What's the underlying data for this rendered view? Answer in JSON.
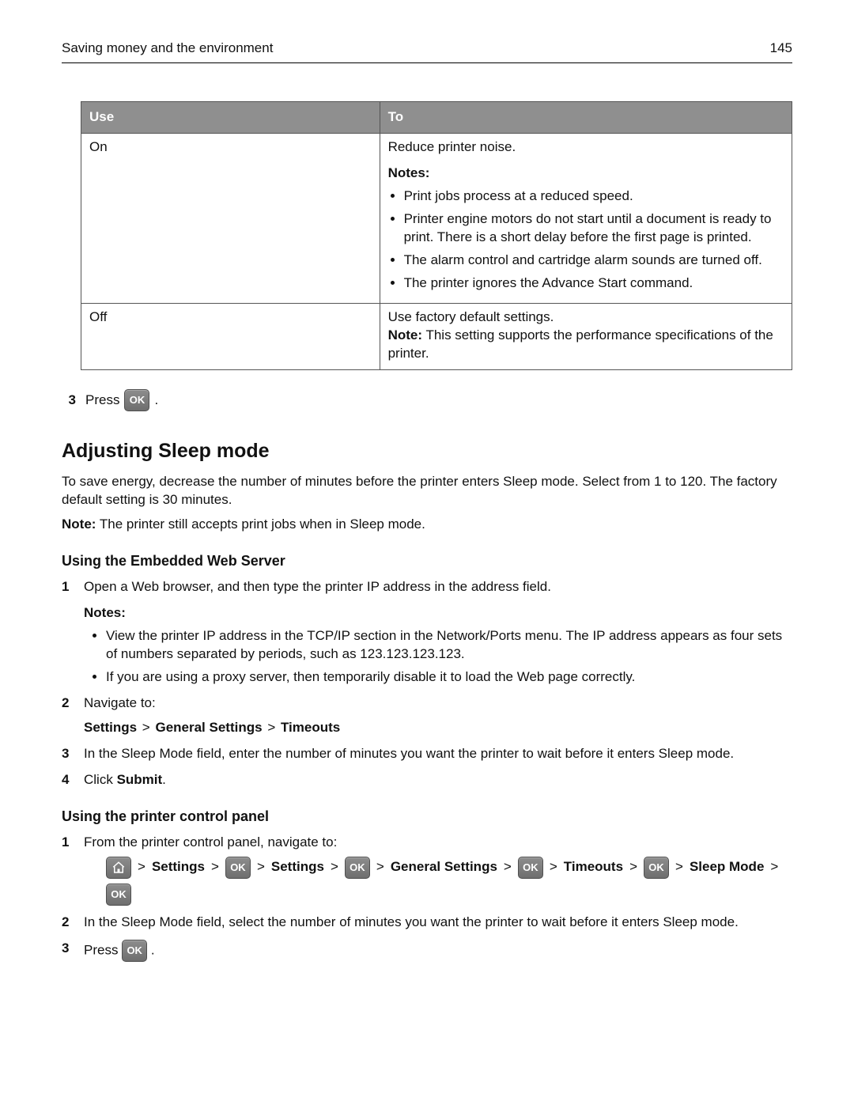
{
  "header": {
    "title": "Saving money and the environment",
    "page_number": "145"
  },
  "table": {
    "headers": [
      "Use",
      "To"
    ],
    "rows": [
      {
        "use": "On",
        "to_intro": "Reduce printer noise.",
        "notes_label": "Notes:",
        "notes": [
          "Print jobs process at a reduced speed.",
          "Printer engine motors do not start until a document is ready to print. There is a short delay before the first page is printed.",
          "The alarm control and cartridge alarm sounds are turned off.",
          "The printer ignores the Advance Start command."
        ]
      },
      {
        "use": "Off",
        "to_intro": "Use factory default settings.",
        "note_bold": "Note:",
        "note_rest": " This setting supports the performance specifications of the printer."
      }
    ]
  },
  "step3_press": {
    "num": "3",
    "press": "Press ",
    "dot": "."
  },
  "section_title": "Adjusting Sleep mode",
  "section_body": "To save energy, decrease the number of minutes before the printer enters Sleep mode. Select from 1 to 120. The factory default setting is 30 minutes.",
  "section_note_bold": "Note:",
  "section_note_rest": " The printer still accepts print jobs when in Sleep mode.",
  "ews": {
    "heading": "Using the Embedded Web Server",
    "step1": "Open a Web browser, and then type the printer IP address in the address field.",
    "notes_label": "Notes:",
    "notes": [
      "View the printer IP address in the TCP/IP section in the Network/Ports menu. The IP address appears as four sets of numbers separated by periods, such as 123.123.123.123.",
      "If you are using a proxy server, then temporarily disable it to load the Web page correctly."
    ],
    "step2_intro": "Navigate to:",
    "step2_path": {
      "a": "Settings",
      "b": "General Settings",
      "c": "Timeouts"
    },
    "step3": "In the Sleep Mode field, enter the number of minutes you want the printer to wait before it enters Sleep mode.",
    "step4_pre": "Click ",
    "step4_bold": "Submit",
    "step4_post": "."
  },
  "panel": {
    "heading": "Using the printer control panel",
    "step1": "From the printer control panel, navigate to:",
    "nav": {
      "settings": "Settings",
      "general": "General Settings",
      "timeouts": "Timeouts",
      "sleep": "Sleep Mode"
    },
    "step2": "In the Sleep Mode field, select the number of minutes you want the printer to wait before it enters Sleep mode.",
    "step3_num": "3",
    "step3_press": "Press ",
    "step3_dot": "."
  },
  "icons": {
    "ok_label": "OK"
  },
  "gt": ">"
}
